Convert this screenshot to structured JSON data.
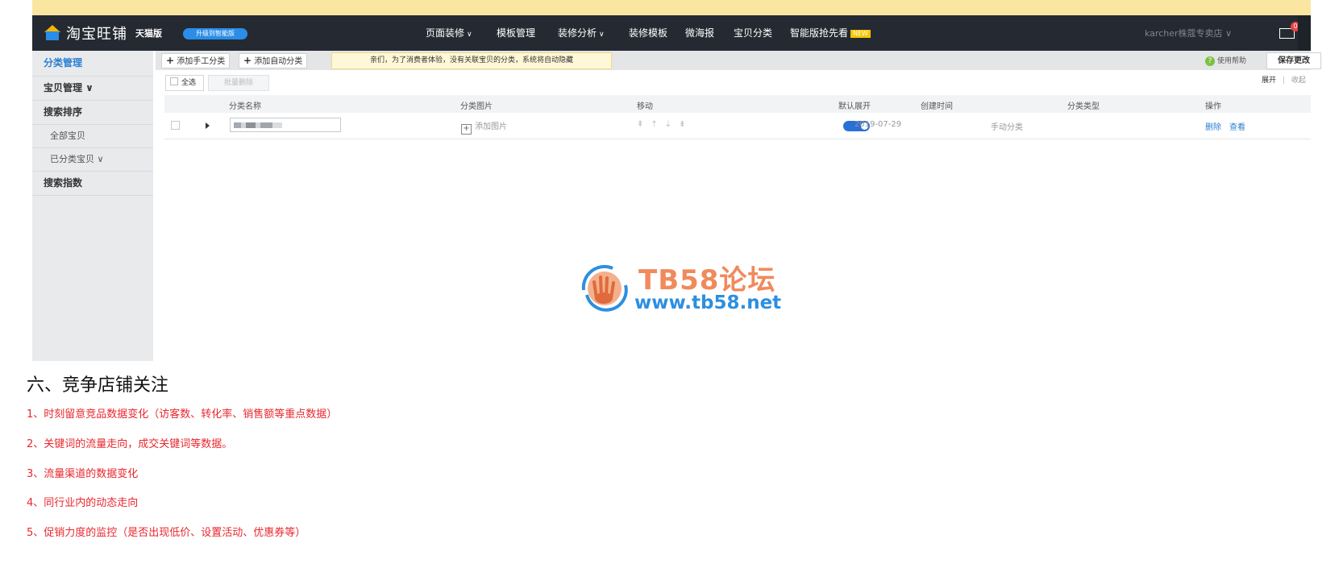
{
  "header": {
    "brand": "淘宝旺铺",
    "edition": "天猫版",
    "upgrade_label": "升级到智能版",
    "nav": [
      {
        "label": "页面装修",
        "chevron": "∨"
      },
      {
        "label": "模板管理",
        "chevron": ""
      },
      {
        "label": "装修分析",
        "chevron": "∨"
      },
      {
        "label": "装修模板",
        "chevron": ""
      },
      {
        "label": "微海报",
        "chevron": ""
      },
      {
        "label": "宝贝分类",
        "chevron": ""
      },
      {
        "label": "智能版抢先看",
        "chevron": ""
      }
    ],
    "new_badge": "NEW",
    "shop_name": "karcher株蔻专卖店 ∨",
    "mail_count": "0"
  },
  "sidebar": {
    "items": [
      {
        "label": "分类管理"
      },
      {
        "label": "宝贝管理 ∨"
      },
      {
        "label": "搜索排序"
      },
      {
        "label": "全部宝贝"
      },
      {
        "label": "已分类宝贝 ∨"
      },
      {
        "label": "搜索指数"
      }
    ]
  },
  "toolbar": {
    "add_manual": "添加手工分类",
    "add_auto": "添加自动分类",
    "tip": "亲们，为了消费者体验，没有关联宝贝的分类，系统将自动隐藏",
    "help": "使用帮助",
    "save": "保存更改"
  },
  "list_controls": {
    "select_all": "全选",
    "batch_delete": "批量删除",
    "expand": "展开",
    "collapse": "收起"
  },
  "table": {
    "headers": [
      "分类名称",
      "分类图片",
      "移动",
      "默认展开",
      "创建时间",
      "分类类型",
      "操作"
    ],
    "rows": [
      {
        "add_image": "添加图片",
        "move_icons": "⇞⇡⇣⇟",
        "default_expand": true,
        "created": "2019-07-29",
        "type": "手动分类",
        "op_delete": "删除",
        "op_view": "查看"
      }
    ]
  },
  "watermark": {
    "title": "TB58论坛",
    "url": "www.tb58.net"
  },
  "article": {
    "heading": "六、竞争店铺关注",
    "points": [
      "1、时刻留意竞品数据变化（访客数、转化率、销售额等重点数据）",
      "2、关键词的流量走向，成交关键词等数据。",
      "3、流量渠道的数据变化",
      "4、同行业内的动态走向",
      "5、促销力度的监控（是否出现低价、设置活动、优惠券等）"
    ]
  },
  "colors": {
    "topbar": "#252a32",
    "accent": "#2a7fd4",
    "notice": "#fbe6a1",
    "article_text": "#e8272e",
    "watermark_orange": "#f08a5c",
    "watermark_blue": "#2c8fe0"
  }
}
